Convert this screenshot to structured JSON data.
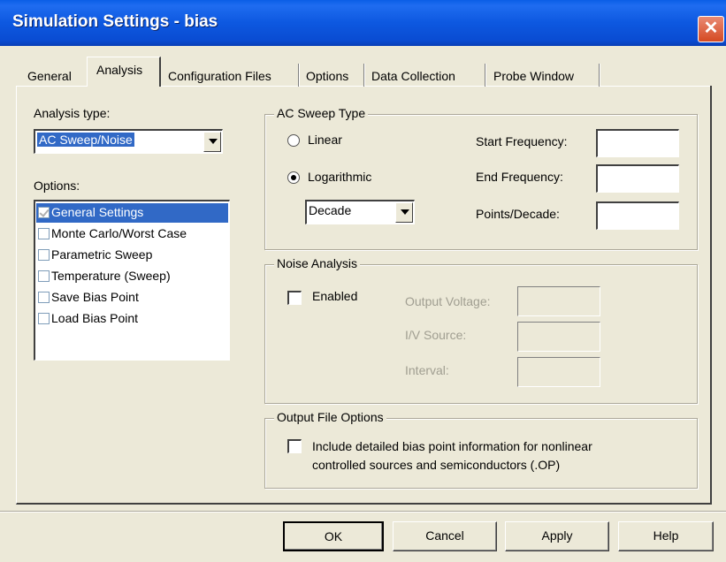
{
  "window": {
    "title": "Simulation Settings - bias",
    "close_glyph": "✕"
  },
  "tabs": [
    {
      "label": "General"
    },
    {
      "label": "Analysis"
    },
    {
      "label": "Configuration Files"
    },
    {
      "label": "Options"
    },
    {
      "label": "Data Collection"
    },
    {
      "label": "Probe Window"
    }
  ],
  "analysis": {
    "type_label": "Analysis type:",
    "type_value": "AC Sweep/Noise",
    "options_label": "Options:",
    "options": [
      {
        "label": "General Settings",
        "checked": true,
        "selected": true
      },
      {
        "label": "Monte Carlo/Worst Case",
        "checked": false
      },
      {
        "label": "Parametric Sweep",
        "checked": false
      },
      {
        "label": "Temperature (Sweep)",
        "checked": false
      },
      {
        "label": "Save Bias Point",
        "checked": false
      },
      {
        "label": "Load Bias Point",
        "checked": false
      }
    ]
  },
  "ac_sweep": {
    "title": "AC Sweep Type",
    "linear_label": "Linear",
    "log_label": "Logarithmic",
    "selected": "Logarithmic",
    "log_unit": "Decade",
    "start_label": "Start Frequency:",
    "end_label": "End Frequency:",
    "points_label": "Points/Decade:",
    "start_value": "",
    "end_value": "",
    "points_value": ""
  },
  "noise": {
    "title": "Noise Analysis",
    "enabled_label": "Enabled",
    "output_voltage_label": "Output Voltage:",
    "iv_source_label": "I/V Source:",
    "interval_label": "Interval:"
  },
  "output_file": {
    "title": "Output File Options",
    "line1": "Include detailed bias point information for nonlinear",
    "line2": "controlled sources and semiconductors (.OP)"
  },
  "buttons": {
    "ok": "OK",
    "cancel": "Cancel",
    "apply": "Apply",
    "help": "Help"
  }
}
